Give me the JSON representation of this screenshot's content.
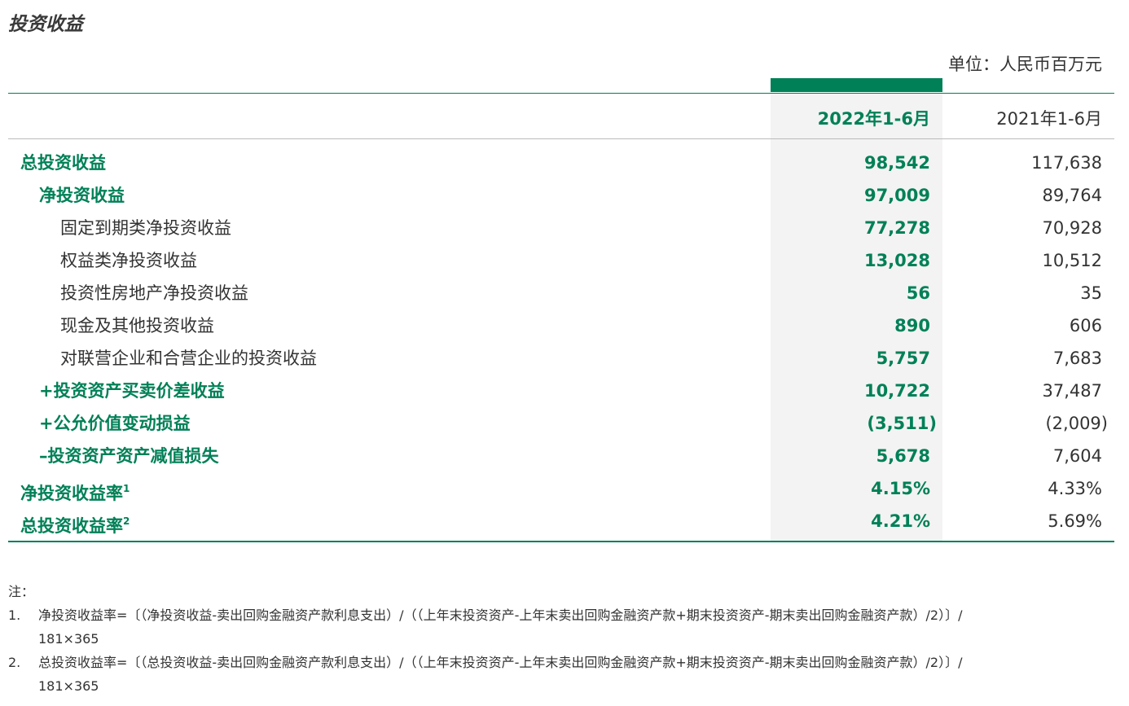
{
  "title": "投资收益",
  "unit": "单位：人民币百万元",
  "headers": {
    "current": "2022年1-6月",
    "previous": "2021年1-6月"
  },
  "rows": [
    {
      "label": "总投资收益",
      "sup": "",
      "current": "98,542",
      "previous": "117,638"
    },
    {
      "label": "净投资收益",
      "sup": "",
      "current": "97,009",
      "previous": "89,764"
    },
    {
      "label": "固定到期类净投资收益",
      "sup": "",
      "current": "77,278",
      "previous": "70,928"
    },
    {
      "label": "权益类净投资收益",
      "sup": "",
      "current": "13,028",
      "previous": "10,512"
    },
    {
      "label": "投资性房地产净投资收益",
      "sup": "",
      "current": "56",
      "previous": "35"
    },
    {
      "label": "现金及其他投资收益",
      "sup": "",
      "current": "890",
      "previous": "606"
    },
    {
      "label": "对联营企业和合营企业的投资收益",
      "sup": "",
      "current": "5,757",
      "previous": "7,683"
    },
    {
      "label": "+投资资产买卖价差收益",
      "sup": "",
      "current": "10,722",
      "previous": "37,487"
    },
    {
      "label": "+公允价值变动损益",
      "sup": "",
      "current": "(3,511)",
      "previous": "(2,009)"
    },
    {
      "label": "–投资资产资产减值损失",
      "sup": "",
      "current": "5,678",
      "previous": "7,604"
    },
    {
      "label": "净投资收益率",
      "sup": "1",
      "current": "4.15%",
      "previous": "4.33%"
    },
    {
      "label": "总投资收益率",
      "sup": "2",
      "current": "4.21%",
      "previous": "5.69%"
    }
  ],
  "notes": {
    "heading": "注：",
    "items": [
      {
        "num": "1.",
        "line1": "净投资收益率=〔（净投资收益-卖出回购金融资产款利息支出）/（（上年末投资资产-上年末卖出回购金融资产款+期末投资资产-期末卖出回购金融资产款）/2）〕/",
        "line2": "181×365"
      },
      {
        "num": "2.",
        "line1": "总投资收益率=〔（总投资收益-卖出回购金融资产款利息支出）/（（上年末投资资产-上年末卖出回购金融资产款+期末投资资产-期末卖出回购金融资产款）/2）〕/",
        "line2": "181×365"
      }
    ]
  }
}
